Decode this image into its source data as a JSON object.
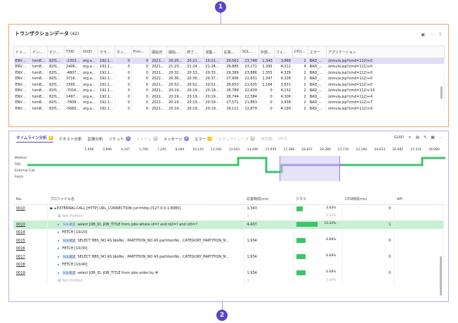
{
  "callouts": [
    "1",
    "2"
  ],
  "panel1": {
    "title": "トランザクションデータ",
    "count": "(42)",
    "icons": [
      "export-icon",
      "more-icon",
      "help-icon"
    ],
    "icon_glyphs": [
      "▣",
      "···",
      "?"
    ],
    "columns": [
      "ドメ…",
      "イン…",
      "ビジ…",
      "TXID",
      "GUID",
      "クラ…",
      "ネッ…",
      "Fron…",
      "開始日",
      "開始…",
      "終了…",
      "収集…",
      "応答…",
      "SQL…",
      "外部…",
      "フェ…",
      "CPU…",
      "エラー",
      "アプリケーション"
    ],
    "rows": [
      [
        "ENV…",
        "tom8…",
        "82f1…",
        "-2203…",
        "org.a…",
        "192.1…",
        "0",
        "0",
        "2021…",
        "20:20…",
        "20:21…",
        "20:21…",
        "29,561",
        "23,748",
        "1,343",
        "3,868",
        "2",
        "BAD_…",
        "/simula.jsp?cmd=112)+0"
      ],
      [
        "ENV…",
        "tom8…",
        "82f1…",
        "2406…",
        "org.a…",
        "192.1…",
        "0",
        "0",
        "2021…",
        "21:23…",
        "21:24…",
        "21:24…",
        "29,885",
        "23,171",
        "1,395",
        "4,212",
        "4",
        "BAD_…",
        "/simula.jsp?cmd=111)+0"
      ],
      [
        "ENV…",
        "tom8…",
        "82f1…",
        "-4807…",
        "org.a…",
        "192.1…",
        "0",
        "0",
        "2021…",
        "20:32…",
        "20:33…",
        "20:33…",
        "29,389",
        "23,886",
        "1,355",
        "4,328",
        "2",
        "BAD_…",
        "/simula.jsp?cmd=112)+0"
      ],
      [
        "ENV…",
        "tom8…",
        "82f1…",
        "3716…",
        "org.a…",
        "192.1…",
        "0",
        "0",
        "2021…",
        "20:36…",
        "20:36…",
        "20:37…",
        "27,906",
        "22,631",
        "1,347",
        "4,328",
        "2",
        "BAD_…",
        "/simula.jsp?cmd=112)+0"
      ],
      [
        "ENV…",
        "tom8…",
        "82f1…",
        "3395…",
        "org.a…",
        "192.1…",
        "0",
        "0",
        "2021…",
        "20:52…",
        "20:52…",
        "20:52…",
        "26,653",
        "21,635",
        "1,164",
        "3,931",
        "2",
        "BAD_…",
        "/simula.jsp?cmd=112)+0"
      ],
      [
        "ENV…",
        "tom8…",
        "82f1…",
        "-7016…",
        "org.a…",
        "192.1…",
        "0",
        "0",
        "2021…",
        "20:19…",
        "20:19…",
        "20:19…",
        "28,789",
        "22,639",
        "0",
        "4,132",
        "2",
        "BAD_…",
        "/simula.jsp?cmd=112)+10"
      ],
      [
        "ENV…",
        "tom8…",
        "82f1…",
        "1497…",
        "org.a…",
        "192.1…",
        "0",
        "0",
        "2021…",
        "20:19…",
        "20:19…",
        "20:19…",
        "28,744",
        "22,584",
        "0",
        "4,306",
        "2",
        "BAD_…",
        "/simula.jsp?cmd=112)+4"
      ],
      [
        "ENV…",
        "tom8…",
        "82f1…",
        "-7608…",
        "org.a…",
        "192.1…",
        "0",
        "0",
        "2021…",
        "20:19…",
        "20:19…",
        "20:19…",
        "27,571",
        "21,863",
        "0",
        "3,938",
        "2",
        "BAD_…",
        "/simula.jsp?cmd=112)+7"
      ],
      [
        "ENV…",
        "tom8…",
        "82f1…",
        "-5660…",
        "org.a…",
        "192.1…",
        "0",
        "0",
        "2021…",
        "20:19…",
        "20:19…",
        "20:19…",
        "29,111",
        "22,879",
        "0",
        "4,199",
        "2",
        "BAD_…",
        "/simula.jsp?cmd=112)+9"
      ]
    ],
    "selected_row": 0
  },
  "panel2": {
    "tabs": [
      {
        "label": "タイムライン分析",
        "badge": "1",
        "badge_color": "#f5c518",
        "state": "active"
      },
      {
        "label": "テキスト分析",
        "badge": "",
        "badge_color": "",
        "state": "normal"
      },
      {
        "label": "区間分析",
        "badge": "",
        "badge_color": "",
        "state": "normal"
      },
      {
        "label": "ソケット",
        "badge": "1",
        "badge_color": "#8f80de",
        "state": "normal"
      },
      {
        "label": "ファイル",
        "badge": "0",
        "badge_color": "#cccccc",
        "state": "disabled"
      },
      {
        "label": "メッセージ",
        "badge": "4",
        "badge_color": "#8f80de",
        "state": "normal"
      },
      {
        "label": "エラー",
        "badge": "1",
        "badge_color": "#f5c518",
        "state": "normal"
      },
      {
        "label": "スタックトレース",
        "badge": "0",
        "badge_color": "#cccccc",
        "state": "disabled"
      },
      {
        "label": "非同期",
        "badge": "",
        "badge_color": "",
        "state": "disabled"
      },
      {
        "label": "OICS",
        "badge": "",
        "badge_color": "",
        "state": "disabled"
      }
    ],
    "tools": [
      "GUID",
      "share-icon",
      "export-icon",
      "edit-icon",
      "fullscreen-icon",
      "more-icon"
    ],
    "tool_glyphs": [
      "GUID",
      "⋖",
      "▤",
      "✎",
      "▦",
      "···"
    ],
    "timeline": {
      "ticks": [
        "1,448",
        "2,896",
        "4,347",
        "5,796",
        "7,245",
        "8,694",
        "10,143",
        "11,592",
        "13,041",
        "14,490",
        "15,939",
        "17,388",
        "18,837",
        "20,286",
        "21,735",
        "23,184",
        "24,633",
        "26,082",
        "27,531",
        "28,980"
      ],
      "lanes": [
        "Method",
        "SQL",
        "External Call",
        "Fetch"
      ],
      "accent": "#3ec46a",
      "selection_color": "#8f80de"
    },
    "table": {
      "columns": [
        "No.",
        "プロファイル名",
        "応答時間(ms)",
        "クラス",
        "CPU時間(ms)",
        "API"
      ],
      "rows": [
        {
          "no": "0010",
          "type": "ext",
          "tag": "",
          "name": "EXTERNAL-CALL [HTTP] URL_CONNECTION [url=http://127.0.0.1:8080]",
          "time": "1,343",
          "pct": "4.64%",
          "pct_value": 4.64,
          "cpu": "0",
          "hl": false,
          "dim": false
        },
        {
          "no": "",
          "type": "dot",
          "tag": "",
          "name": "Not Profiled",
          "time": "1",
          "pct": "0.00%",
          "pct_value": 0,
          "cpu": "",
          "hl": false,
          "dim": true
        },
        {
          "no": "0013",
          "type": "sql",
          "tag": "SQL確認",
          "name": "select JOB_ID, JOB_TITLE from jobs where id=? and id2=? and id3=?",
          "time": "4,407",
          "pct": "15.22%",
          "pct_value": 15.22,
          "cpu": "1",
          "hl": true,
          "dim": false
        },
        {
          "no": "0014",
          "type": "spk",
          "tag": "",
          "name": "FETCH [10/20]",
          "time": "",
          "pct": "",
          "pct_value": 0,
          "cpu": "",
          "hl": false,
          "dim": false
        },
        {
          "no": "0015",
          "type": "sql",
          "tag": "SQL確認",
          "name": "SELECT BBS_NO AS bbsNo , PARTITION_NO AS partitionNo , CATEGORY_PARTITION_N…",
          "time": "1,934",
          "pct": "6.68%",
          "pct_value": 6.68,
          "cpu": "0",
          "hl": false,
          "dim": false
        },
        {
          "no": "0016",
          "type": "spk",
          "tag": "",
          "name": "FETCH [10/30]",
          "time": "",
          "pct": "",
          "pct_value": 0,
          "cpu": "",
          "hl": false,
          "dim": false
        },
        {
          "no": "0017",
          "type": "sql",
          "tag": "SQL確認",
          "name": "SELECT BBS_NO AS bbsNo , PARTITION_NO AS partitionNo , CATEGORY_PARTITION_N…",
          "time": "1,934",
          "pct": "6.68%",
          "pct_value": 6.68,
          "cpu": "0",
          "hl": false,
          "dim": false
        },
        {
          "no": "0018",
          "type": "spk",
          "tag": "",
          "name": "FETCH [10/40]",
          "time": "",
          "pct": "",
          "pct_value": 0,
          "cpu": "",
          "hl": false,
          "dim": false
        },
        {
          "no": "0019",
          "type": "sql",
          "tag": "SQL確認",
          "name": "select JOB_ID, JOB_TITLE from jobs order by #",
          "time": "1,934",
          "pct": "6.68%",
          "pct_value": 6.68,
          "cpu": "0",
          "hl": false,
          "dim": false
        },
        {
          "no": "",
          "type": "dot",
          "tag": "",
          "name": "Not Profiled",
          "time": "1",
          "pct": "0.00%",
          "pct_value": 0,
          "cpu": "",
          "hl": false,
          "dim": true
        }
      ]
    }
  }
}
